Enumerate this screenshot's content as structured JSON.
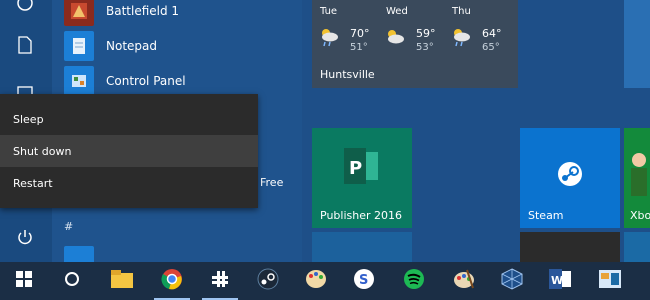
{
  "app_list": {
    "items": [
      {
        "label": "Battlefield 1",
        "icon": "battlefield-icon"
      },
      {
        "label": "Notepad",
        "icon": "notepad-icon"
      },
      {
        "label": "Control Panel",
        "icon": "control-panel-icon"
      }
    ],
    "free_label": "Free",
    "letter_header": "#"
  },
  "power_menu": {
    "items": [
      {
        "label": "Sleep"
      },
      {
        "label": "Shut down"
      },
      {
        "label": "Restart"
      }
    ]
  },
  "weather": {
    "city": "Huntsville",
    "days": [
      {
        "day": "Tue",
        "high": "70°",
        "low": "51°"
      },
      {
        "day": "Wed",
        "high": "59°",
        "low": "53°"
      },
      {
        "day": "Thu",
        "high": "64°",
        "low": "65°"
      }
    ]
  },
  "tiles": {
    "publisher": "Publisher 2016",
    "steam": "Steam",
    "xbox": "Xbox"
  },
  "taskbar": {
    "items": [
      "start-button",
      "cortana-button",
      "file-explorer",
      "chrome",
      "slack",
      "steam",
      "paint",
      "simplenote",
      "spotify",
      "paint-palette",
      "virtualbox",
      "word",
      "settings"
    ]
  },
  "colors": {
    "accent": "#1e4f88",
    "menu": "#2b2b2b",
    "publisher": "#0a7a61",
    "steam": "#0b73cf"
  }
}
